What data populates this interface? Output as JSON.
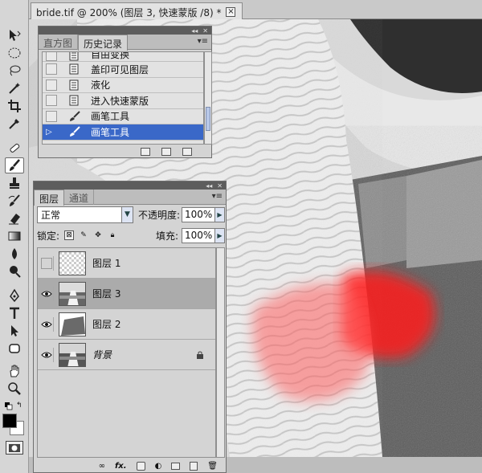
{
  "document": {
    "tab_title": "bride.tif @ 200% (图层 3, 快速蒙版 /8) *",
    "close_label": "×"
  },
  "toolbar": {
    "tools": [
      "move-icon",
      "marquee-icon",
      "lasso-icon",
      "magic-wand-icon",
      "crop-icon",
      "eyedropper-icon",
      "healing-brush-icon",
      "brush-icon",
      "clone-stamp-icon",
      "history-brush-icon",
      "eraser-icon",
      "gradient-icon",
      "blur-icon",
      "dodge-icon",
      "pen-icon",
      "type-icon",
      "path-selection-icon",
      "shape-icon",
      "hand-icon",
      "zoom-icon"
    ],
    "active_tool": "brush-icon",
    "foreground_color": "#000000",
    "background_color": "#ffffff"
  },
  "history_panel": {
    "tabs": [
      "直方图",
      "历史记录"
    ],
    "active_tab": "历史记录",
    "items": [
      {
        "label": "自由变换"
      },
      {
        "label": "盖印可见图层"
      },
      {
        "label": "液化"
      },
      {
        "label": "进入快速蒙版"
      },
      {
        "label": "画笔工具"
      },
      {
        "label": "画笔工具",
        "selected": true
      }
    ]
  },
  "layers_panel": {
    "tabs": [
      "图层",
      "通道"
    ],
    "active_tab": "图层",
    "blend_mode": "正常",
    "opacity_label": "不透明度:",
    "opacity_value": "100%",
    "lock_label": "锁定:",
    "fill_label": "填充:",
    "fill_value": "100%",
    "layers": [
      {
        "name": "图层 1",
        "visible": false
      },
      {
        "name": "图层 3",
        "visible": true,
        "selected": true
      },
      {
        "name": "图层 2",
        "visible": true
      },
      {
        "name": "背景",
        "visible": true,
        "locked": true
      }
    ],
    "footer_icons": [
      "link-icon",
      "fx-icon",
      "mask-icon",
      "adjustment-icon",
      "group-icon",
      "new-layer-icon",
      "delete-icon"
    ],
    "fx_label": "fx."
  },
  "colors": {
    "selection_blue": "#3a68c8",
    "quick_mask_red": "#ff3030"
  }
}
